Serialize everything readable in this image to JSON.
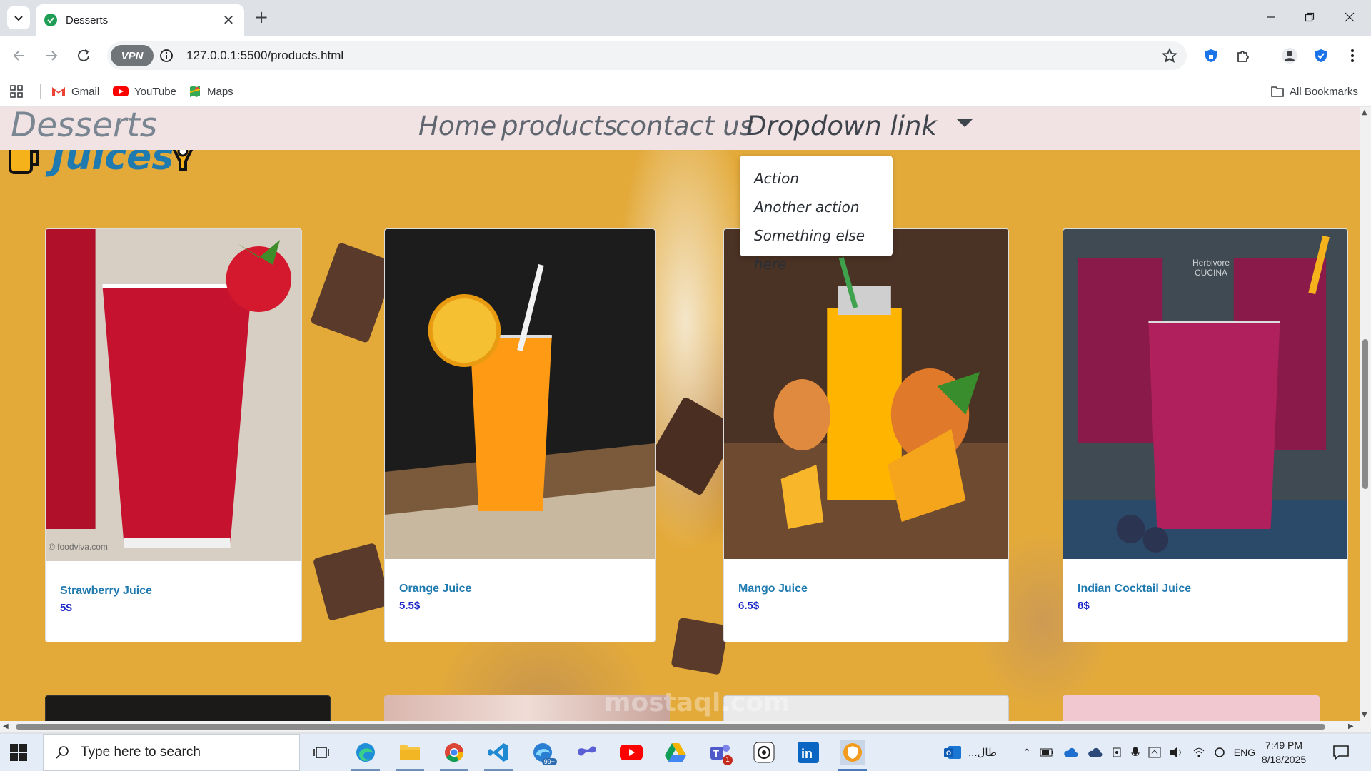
{
  "browser": {
    "tab_title": "Desserts",
    "url": "127.0.0.1:5500/products.html",
    "vpn_label": "VPN",
    "bookmarks": [
      {
        "label": "Gmail"
      },
      {
        "label": "YouTube"
      },
      {
        "label": "Maps"
      }
    ],
    "all_bookmarks_label": "All Bookmarks"
  },
  "site": {
    "brand": "Desserts",
    "nav": [
      {
        "label": "Home"
      },
      {
        "label": "products"
      },
      {
        "label": "contact us"
      },
      {
        "label": "Dropdown link"
      }
    ],
    "dropdown": [
      "Action",
      "Another action",
      "Something else here"
    ],
    "heading": "Juices",
    "products": [
      {
        "name": "Strawberry Juice",
        "price": "5$",
        "watermark": "© foodviva.com"
      },
      {
        "name": "Orange Juice",
        "price": "5.5$"
      },
      {
        "name": "Mango Juice",
        "price": "6.5$"
      },
      {
        "name": "Indian Cocktail Juice",
        "price": "8$",
        "watermark": "Herbivore CUCINA"
      }
    ]
  },
  "taskbar": {
    "search_placeholder": "Type here to search",
    "tray_text": "...طال",
    "language": "ENG",
    "time": "7:49 PM",
    "date": "8/18/2025",
    "teams_badge": "1",
    "edge_badge": "99+"
  },
  "watermark": "mostaql.com",
  "colors": {
    "page_bg": "#e3aa3a",
    "navbar_bg": "#f1e2e4",
    "heading": "#1f7ab0",
    "price": "#1a26c8"
  }
}
